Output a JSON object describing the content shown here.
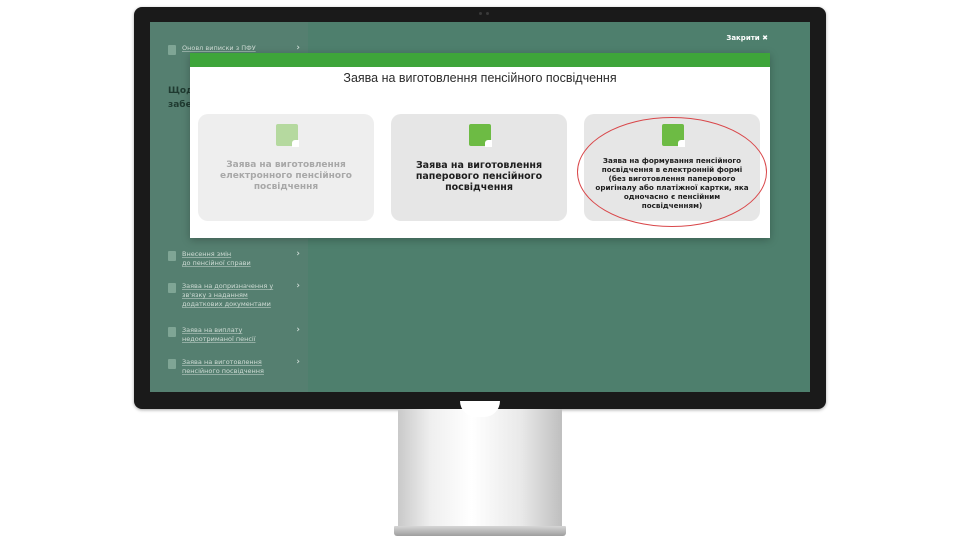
{
  "sidebar": {
    "top_item": "Оновл виписки з ПФУ",
    "heading_lines": [
      "Щод",
      "забе"
    ],
    "items": [
      {
        "label_lines": [
          "Внесення змін",
          "до пенсійної справи"
        ]
      },
      {
        "label_lines": [
          "Заява на допризначення у",
          "зв'язку з наданням",
          "додаткових документами"
        ]
      },
      {
        "label_lines": [
          "Заява на виплату",
          "недоотриманої пенсії"
        ]
      },
      {
        "label_lines": [
          "Заява на виготовлення",
          "пенсійного посвідчення"
        ]
      }
    ]
  },
  "close_label": "Закрити ✖",
  "modal": {
    "title": "Заява на виготовлення пенсійного посвідчення",
    "cards": [
      {
        "label": "Заява на виготовлення електронного пенсійного посвідчення",
        "state": "disabled"
      },
      {
        "label": "Заява на виготовлення паперового пенсійного посвідчення",
        "state": "enabled"
      },
      {
        "label": "Заява на формування пенсійного посвідчення в електронній формі (без виготовлення паперового оригіналу або платіжної картки, яка одночасно є пенсійним посвідченням)",
        "state": "enabled",
        "highlighted": true
      }
    ]
  },
  "colors": {
    "screen_bg": "#4e7f6d",
    "modal_bar": "#3ea53a",
    "icon_green": "#6dbb44",
    "icon_disabled": "#b5d99f",
    "highlight": "#d9474a"
  }
}
